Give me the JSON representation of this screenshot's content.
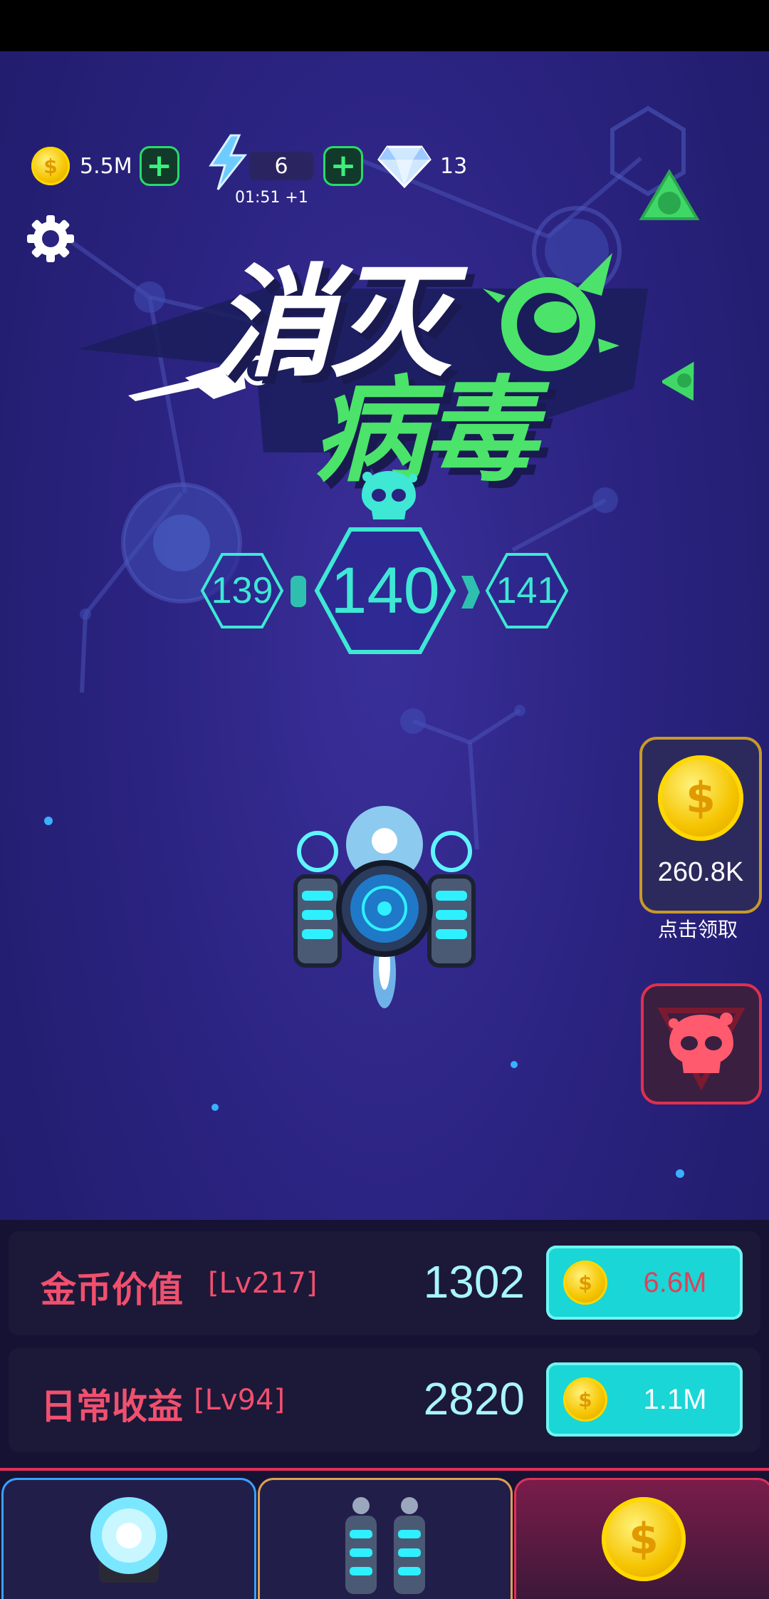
{
  "resources": {
    "coins": "5.5M",
    "coin_symbol": "$",
    "energy": "6",
    "energy_timer": "01:51 +1",
    "gems": "13"
  },
  "title": {
    "main": "消灭",
    "sub": "病毒"
  },
  "levels": {
    "previous": "139",
    "current": "140",
    "next": "141"
  },
  "reward": {
    "amount": "260.8K",
    "label": "点击领取"
  },
  "upgrades": [
    {
      "name": "金币价值",
      "level": "[Lv217]",
      "value": "1302",
      "cost": "6.6M",
      "cost_color": "#e0405a"
    },
    {
      "name": "日常收益",
      "level": "[Lv94]",
      "value": "2820",
      "cost": "1.1M",
      "cost_color": "#ffffff"
    }
  ],
  "tabs": [
    {
      "icon": "energy-orb-icon",
      "active": false,
      "border": "#3aa0ff"
    },
    {
      "icon": "twin-cannons-icon",
      "active": false,
      "border": "#e0a050"
    },
    {
      "icon": "coin-icon",
      "active": true,
      "border": "#e0305a"
    }
  ],
  "colors": {
    "accent_cyan": "#1ad6d6",
    "virus_green": "#4be36a",
    "level_teal": "#3ee8d4",
    "upgrade_label": "#f0506e"
  }
}
